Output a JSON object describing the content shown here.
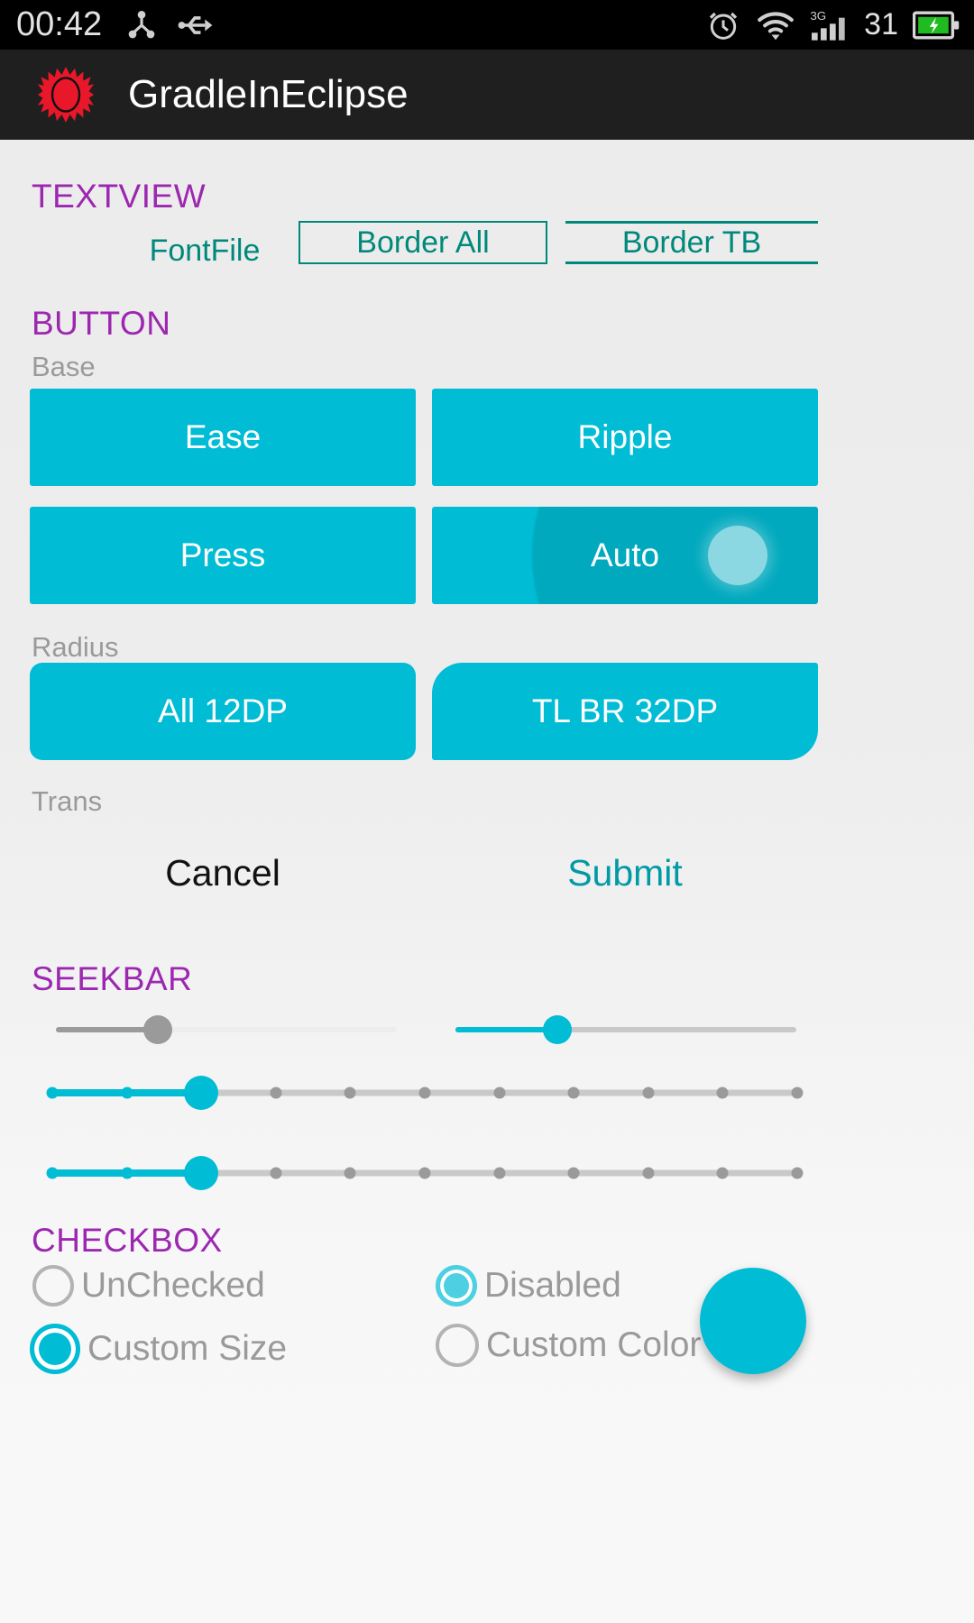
{
  "status_bar": {
    "time": "00:42",
    "battery_percent": "31",
    "icons": [
      "share-icon",
      "usb-icon",
      "alarm-icon",
      "wifi-icon",
      "signal-3g-icon",
      "battery-charging-icon"
    ],
    "signal_label": "3G",
    "background": "#000000"
  },
  "title_bar": {
    "app_title": "GradleInEclipse",
    "logo": "sun-eclipse-icon",
    "logo_color": "#E8172A",
    "background": "#1F1F1F"
  },
  "theme": {
    "accent": "#00BCD4",
    "section_header_color": "#9C27B0",
    "teal_text": "#00897B",
    "sub_label_color": "#9A9A9A",
    "page_background": "#ECECEC"
  },
  "sections": {
    "textview": {
      "header": "TEXTVIEW",
      "items": [
        {
          "label": "FontFile",
          "style": "plain"
        },
        {
          "label": "Border All",
          "style": "border-all"
        },
        {
          "label": "Border TB",
          "style": "border-top-bottom"
        }
      ]
    },
    "button": {
      "header": "BUTTON",
      "groups": [
        {
          "label": "Base",
          "buttons": [
            {
              "label": "Ease",
              "state": "normal"
            },
            {
              "label": "Ripple",
              "state": "normal"
            },
            {
              "label": "Press",
              "state": "normal"
            },
            {
              "label": "Auto",
              "state": "pressed-ripple"
            }
          ]
        },
        {
          "label": "Radius",
          "buttons": [
            {
              "label": "All 12DP",
              "state": "normal"
            },
            {
              "label": "TL BR 32DP",
              "state": "normal"
            }
          ]
        },
        {
          "label": "Trans",
          "buttons": [
            {
              "label": "Cancel",
              "state": "flat-dark"
            },
            {
              "label": "Submit",
              "state": "flat-accent"
            }
          ]
        }
      ]
    },
    "seekbar": {
      "header": "SEEKBAR",
      "bars": [
        {
          "name": "seekbar-plain-left",
          "value": 26,
          "max": 100,
          "ticks": 0,
          "style": "gray-thumb"
        },
        {
          "name": "seekbar-plain-right",
          "value": 30,
          "max": 100,
          "ticks": 0,
          "style": "accent-thumb"
        },
        {
          "name": "seekbar-discrete-1",
          "value": 2,
          "max": 10,
          "ticks": 11,
          "style": "accent-discrete"
        },
        {
          "name": "seekbar-discrete-2",
          "value": 2,
          "max": 10,
          "ticks": 11,
          "style": "accent-discrete"
        }
      ]
    },
    "checkbox": {
      "header": "CHECKBOX",
      "items": [
        {
          "label": "UnChecked",
          "checked": false,
          "enabled": true,
          "size": "normal"
        },
        {
          "label": "Disabled",
          "checked": true,
          "enabled": false,
          "size": "normal"
        },
        {
          "label": "Custom Size",
          "checked": true,
          "enabled": true,
          "size": "large"
        },
        {
          "label": "Custom Color",
          "checked": false,
          "enabled": true,
          "size": "normal"
        }
      ]
    }
  },
  "fab": {
    "name": "floating-action-button",
    "color": "#00BCD4"
  }
}
